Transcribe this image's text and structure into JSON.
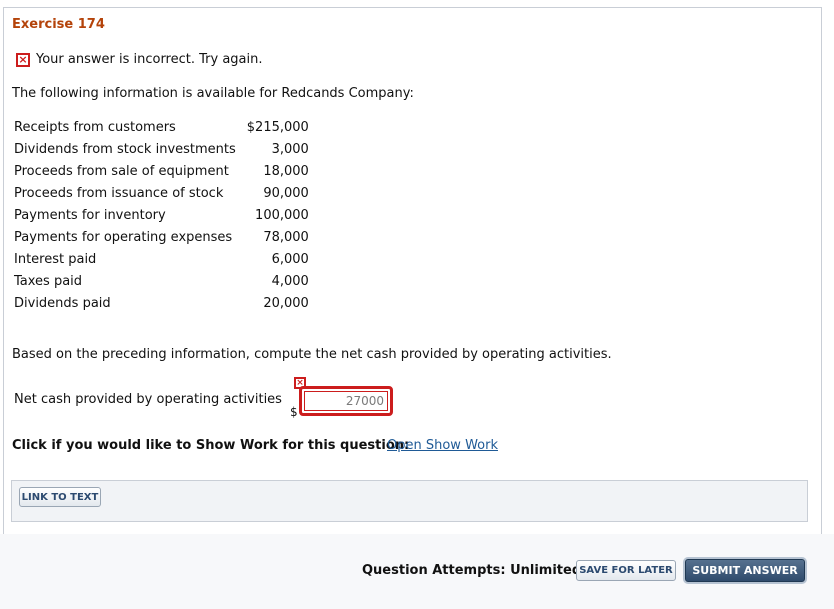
{
  "exercise": {
    "title": "Exercise 174"
  },
  "feedback": {
    "icon": "error-x-icon",
    "message": "Your answer is incorrect.  Try again.",
    "color": "#cc1d1d"
  },
  "intro": "The following information is available for Redcands Company:",
  "items": [
    {
      "label": "Receipts from customers",
      "amount": "$215,000"
    },
    {
      "label": "Dividends from stock investments",
      "amount": "3,000"
    },
    {
      "label": "Proceeds from sale of equipment",
      "amount": "18,000"
    },
    {
      "label": "Proceeds from issuance of stock",
      "amount": "90,000"
    },
    {
      "label": "Payments for inventory",
      "amount": "100,000"
    },
    {
      "label": "Payments for operating expenses",
      "amount": "78,000"
    },
    {
      "label": "Interest paid",
      "amount": "6,000"
    },
    {
      "label": "Taxes paid",
      "amount": "4,000"
    },
    {
      "label": "Dividends paid",
      "amount": "20,000"
    }
  ],
  "question": "Based on the preceding information, compute the net cash provided by operating activities.",
  "answer": {
    "label": "Net cash provided by operating activities",
    "currency": "$",
    "value": "27000",
    "status_icon": "error-x-icon"
  },
  "show_work": {
    "prompt": "Click if you would like to Show Work for this question:",
    "link": "Open Show Work"
  },
  "link_to_text": "LINK TO TEXT",
  "footer": {
    "attempts": "Question Attempts: Unlimited",
    "save_label": "SAVE FOR LATER",
    "submit_label": "SUBMIT ANSWER",
    "submit_color": "#2f4b6c"
  },
  "colors": {
    "title": "#b4430a",
    "link": "#1f5a96"
  }
}
